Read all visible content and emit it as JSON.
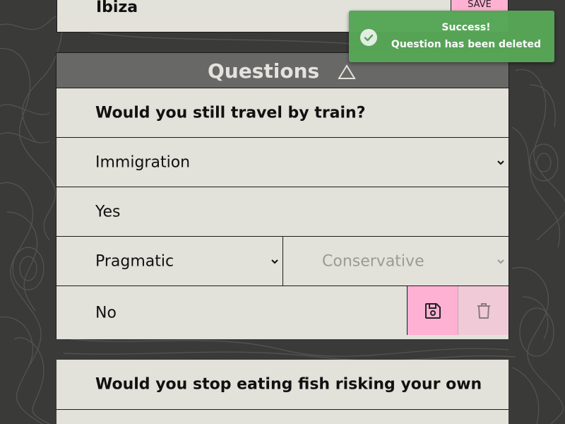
{
  "colors": {
    "background": "#3a3a39",
    "card": "#e2e1da",
    "header": "#686867",
    "accent_pink": "#ffb1d4",
    "toast_green": "#57a657"
  },
  "top_card": {
    "name": "Ibiza",
    "save_label": "SAVE"
  },
  "questions": {
    "title": "Questions",
    "collapse_icon": "triangle-up-icon",
    "items": [
      {
        "question": "Would you still travel by train?",
        "category": "Immigration",
        "answer_yes": "Yes",
        "yes_trait": "Pragmatic",
        "yes_trait_alt": "Conservative",
        "answer_no": "No",
        "save_icon": "floppy-disk-icon",
        "delete_icon": "trash-icon"
      },
      {
        "question": "Would you stop eating fish risking your own he"
      }
    ]
  },
  "toast": {
    "icon": "check-circle-icon",
    "title": "Success!",
    "message": "Question has been deleted"
  }
}
